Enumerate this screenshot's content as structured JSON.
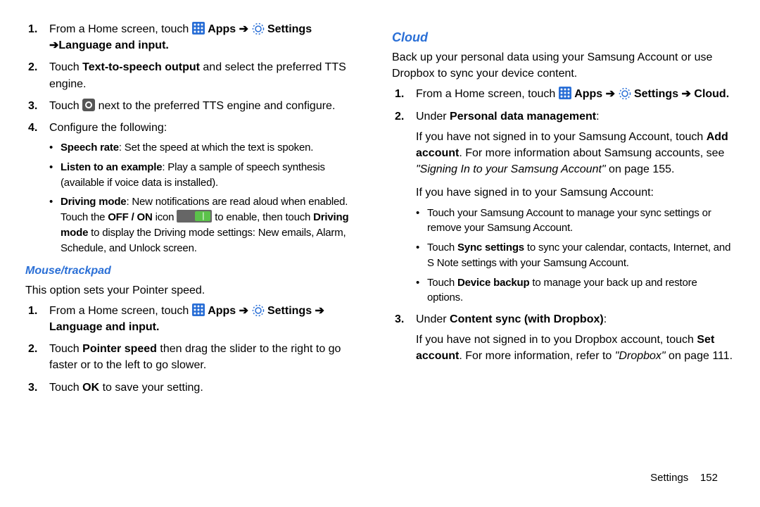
{
  "left": {
    "steps": [
      {
        "num": "1.",
        "pre": "From a Home screen, touch ",
        "after_apps": " Apps ",
        "arrow1": "➔",
        "after_gear": " Settings ",
        "arrow2": "➔",
        "tail": "Language and input."
      },
      {
        "num": "2.",
        "pre": "Touch ",
        "bold": "Text-to-speech output",
        "post": " and select the preferred TTS engine."
      },
      {
        "num": "3.",
        "pre": "Touch ",
        "post": " next to the preferred TTS engine and configure."
      },
      {
        "num": "4.",
        "text": "Configure the following:",
        "bullets": [
          {
            "bold": "Speech rate",
            "text": ": Set the speed at which the text is spoken."
          },
          {
            "bold": "Listen to an example",
            "text": ": Play a sample of speech synthesis (available if voice data is installed)."
          },
          {
            "bold": "Driving mode",
            "text_pre": ": New notifications are read aloud when enabled. Touch the ",
            "offon": "OFF / ON",
            "text_mid": " icon ",
            "text_after_switch": " to enable, then touch ",
            "bold2": "Driving mode",
            "text_tail": " to display the Driving mode settings: New emails, Alarm, Schedule, and Unlock screen."
          }
        ]
      }
    ],
    "mouse_heading": "Mouse/trackpad",
    "mouse_intro": "This option sets your Pointer speed.",
    "mouse_steps": [
      {
        "num": "1.",
        "pre": "From a Home screen, touch ",
        "after_apps": " Apps ",
        "arrow1": "➔",
        "after_gear": " Settings ",
        "arrow2": "➔",
        "tail": " Language and input."
      },
      {
        "num": "2.",
        "pre": "Touch ",
        "bold": "Pointer speed",
        "post": " then drag the slider to the right to go faster or to the left to go slower."
      },
      {
        "num": "3.",
        "pre": "Touch ",
        "bold": "OK",
        "post": " to save your setting."
      }
    ]
  },
  "right": {
    "heading": "Cloud",
    "intro": "Back up your personal data using your Samsung Account or use Dropbox to sync your device content.",
    "steps": [
      {
        "num": "1.",
        "pre": "From a Home screen, touch ",
        "after_apps": " Apps ",
        "arrow1": "➔",
        "after_gear": " Settings ",
        "arrow2": "➔",
        "tail": " Cloud."
      },
      {
        "num": "2.",
        "pre": "Under ",
        "bold": "Personal data management",
        "post": ":",
        "para1_pre": "If you have not signed in to your Samsung Account, touch ",
        "para1_bold": "Add account",
        "para1_mid": ". For more information about Samsung accounts, see ",
        "para1_italic": "\"Signing In to your Samsung Account\"",
        "para1_tail": " on page 155.",
        "para2": "If you have signed in to your Samsung Account:",
        "bullets": [
          {
            "text": "Touch your Samsung Account to manage your sync settings or remove your Samsung Account."
          },
          {
            "pre": "Touch ",
            "bold": "Sync settings",
            "post": " to sync your calendar, contacts, Internet, and S Note settings with your Samsung Account."
          },
          {
            "pre": "Touch ",
            "bold": "Device backup",
            "post": " to manage your back up and restore options."
          }
        ]
      },
      {
        "num": "3.",
        "pre": "Under ",
        "bold": "Content sync (with Dropbox)",
        "post": ":",
        "para1_pre": "If you have not signed in to you Dropbox account, touch ",
        "para1_bold": "Set account",
        "para1_mid": ". For more information, refer to ",
        "para1_italic": "\"Dropbox\"",
        "para1_tail": " on page 111."
      }
    ]
  },
  "footer": {
    "section": "Settings",
    "page": "152"
  }
}
